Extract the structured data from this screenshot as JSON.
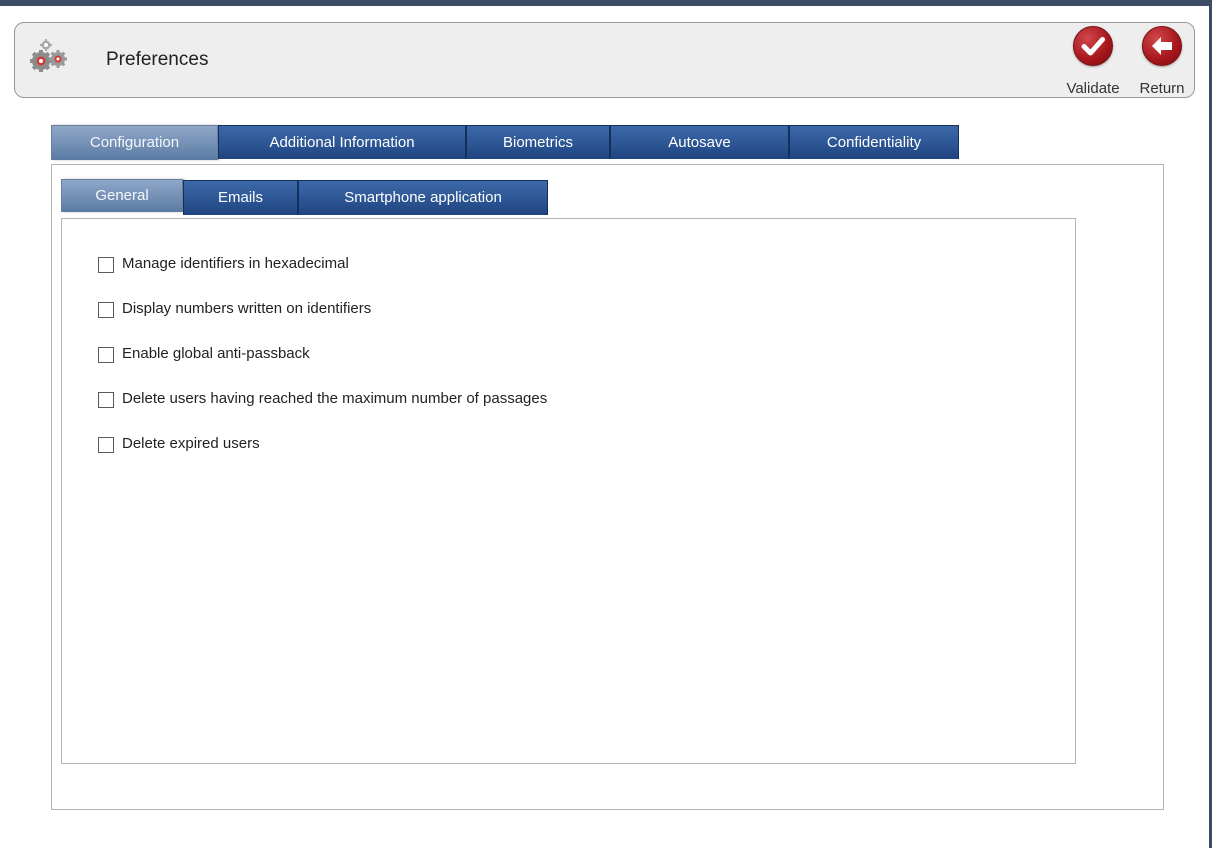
{
  "header": {
    "title": "Preferences",
    "icon": "gears-icon",
    "actions": {
      "validate": {
        "label": "Validate",
        "icon": "checkmark-icon"
      },
      "return": {
        "label": "Return",
        "icon": "arrow-left-icon"
      }
    }
  },
  "tabs": [
    {
      "label": "Configuration",
      "active": true
    },
    {
      "label": "Additional Information",
      "active": false
    },
    {
      "label": "Biometrics",
      "active": false
    },
    {
      "label": "Autosave",
      "active": false
    },
    {
      "label": "Confidentiality",
      "active": false
    }
  ],
  "subtabs": [
    {
      "label": "General",
      "active": true
    },
    {
      "label": "Emails",
      "active": false
    },
    {
      "label": "Smartphone application",
      "active": false
    }
  ],
  "options": [
    {
      "label": "Manage identifiers in hexadecimal",
      "checked": false
    },
    {
      "label": "Display numbers written on identifiers",
      "checked": false
    },
    {
      "label": "Enable global anti-passback",
      "checked": false
    },
    {
      "label": "Delete users having reached the maximum number of passages",
      "checked": false
    },
    {
      "label": "Delete expired users",
      "checked": false
    }
  ],
  "colors": {
    "tab_blue": "#2a5492",
    "tab_active": "#7a93b5",
    "action_red": "#b0191f",
    "frame": "#3d4d66"
  }
}
